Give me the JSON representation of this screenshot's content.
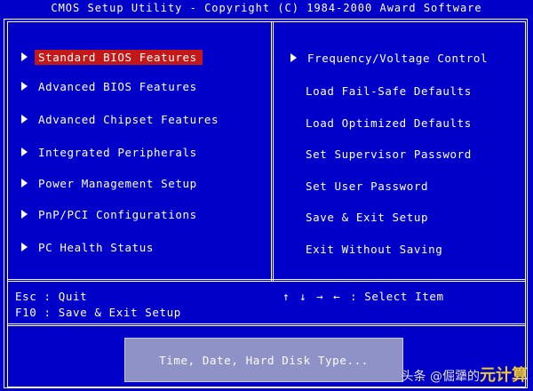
{
  "header": {
    "title": "CMOS Setup Utility - Copyright (C) 1984-2000 Award Software"
  },
  "left_menu": [
    {
      "label": "Standard BIOS Features",
      "selected": true
    },
    {
      "label": "Advanced BIOS Features",
      "selected": false
    },
    {
      "label": "Advanced Chipset Features",
      "selected": false
    },
    {
      "label": "Integrated Peripherals",
      "selected": false
    },
    {
      "label": "Power Management Setup",
      "selected": false
    },
    {
      "label": "PnP/PCI Configurations",
      "selected": false
    },
    {
      "label": "PC Health Status",
      "selected": false
    }
  ],
  "right_menu": [
    {
      "label": "Frequency/Voltage Control",
      "has_submenu": true
    },
    {
      "label": "Load Fail-Safe Defaults",
      "has_submenu": false
    },
    {
      "label": "Load Optimized Defaults",
      "has_submenu": false
    },
    {
      "label": "Set Supervisor Password",
      "has_submenu": false
    },
    {
      "label": "Set User Password",
      "has_submenu": false
    },
    {
      "label": "Save & Exit Setup",
      "has_submenu": false
    },
    {
      "label": "Exit Without Saving",
      "has_submenu": false
    }
  ],
  "footer": {
    "esc_hint": "Esc : Quit",
    "f10_hint": "F10 : Save & Exit Setup",
    "nav_keys": "↑ ↓ → ←",
    "select_hint": ": Select Item"
  },
  "status": {
    "text": "Time, Date, Hard Disk Type..."
  },
  "watermark": {
    "prefix": "头条 @",
    "name": "倔犟的",
    "big": "元计算"
  },
  "colors": {
    "background": "#0000c8",
    "selection": "#c41818",
    "status_box": "#8e92c6"
  }
}
